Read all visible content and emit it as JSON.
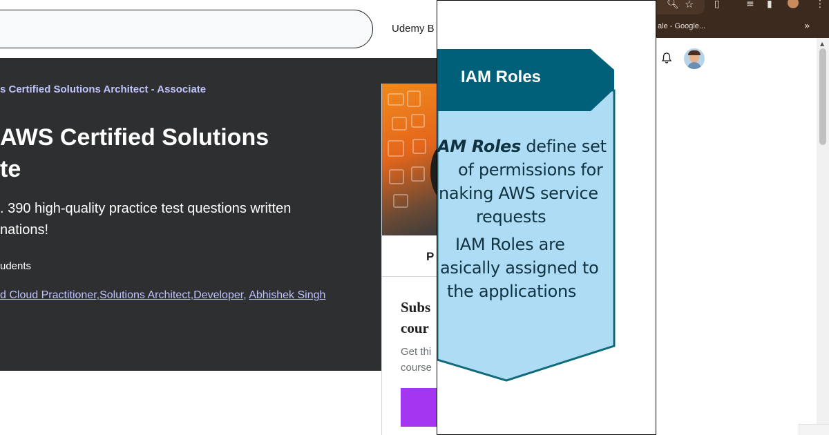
{
  "udemy": {
    "header": {
      "search_placeholder": "",
      "business_link": "Udemy B"
    },
    "breadcrumb": "s Certified Solutions Architect - Associate",
    "title_lines": [
      "AWS Certified Solutions",
      "te"
    ],
    "subtitle_lines": [
      ". 390 high-quality practice test questions written",
      "nations!"
    ],
    "students": "udents",
    "instructors": [
      {
        "text": "d Cloud Practitioner,Solutions Architect,Developer",
        "sep": ", "
      },
      {
        "text": "Abhishek Singh",
        "sep": ""
      }
    ],
    "card": {
      "tab_label": "P",
      "subscribe_heading_lines": [
        "Subs",
        "cour"
      ],
      "subscribe_text_lines": [
        "Get thi",
        "course"
      ],
      "accent_color": "#a435f0"
    },
    "colors": {
      "hero_bg": "#2d2f31",
      "link": "#c0c4fc"
    }
  },
  "slide": {
    "heading": "IAM Roles",
    "body_lines": [
      {
        "italic": "AM Roles",
        "rest": " define set"
      },
      {
        "italic": "",
        "rest": "of permissions for"
      },
      {
        "italic": "",
        "rest": "naking AWS service"
      },
      {
        "italic": "",
        "rest": "requests"
      },
      {
        "italic": "",
        "rest": "IAM Roles are"
      },
      {
        "italic": "",
        "rest": "asically assigned to"
      },
      {
        "italic": "",
        "rest": "the applications"
      }
    ],
    "colors": {
      "banner": "#005f73",
      "body_fill": "#aedcf5",
      "outline": "#0f6b7a"
    }
  },
  "browser": {
    "bookmark_text": "ale - Google...",
    "chevron": "»",
    "icons": [
      "zoom-icon",
      "star-icon",
      "extensions-icon",
      "reading-list-icon",
      "side-panel-icon",
      "profile-icon",
      "bell-icon",
      "avatar"
    ],
    "colors": {
      "frame": "#3c2a1e"
    }
  }
}
